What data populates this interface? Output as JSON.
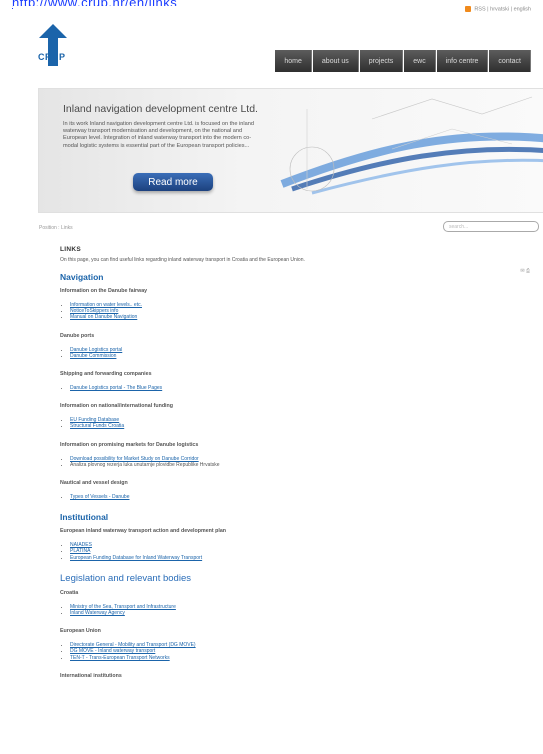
{
  "browser": {
    "url": "http://www.crup.hr/en/links"
  },
  "header": {
    "rss_label": "RSS",
    "languages": "| hrvatski | english",
    "logo_text": "CRUP",
    "nav": [
      "home",
      "about us",
      "projects",
      "ewc",
      "info centre",
      "contact"
    ]
  },
  "hero": {
    "title": "Inland navigation development centre Ltd.",
    "text": "In its work Inland navigation development centre Ltd. is focused on the inland waterway transport modernisation and development, on the national and European level. Integration of inland waterway transport into the modern co-modal logistic systems is essential part of the European transport policies...",
    "button_label": "Read more"
  },
  "breadcrumb": "Position : Links",
  "search": {
    "placeholder": "search..."
  },
  "content": {
    "heading": "LINKS",
    "intro": "On this page, you can find useful links regarding inland waterway transport in Croatia and the European Union.",
    "tools": "✉ ⎙",
    "sections": [
      {
        "title": "Navigation",
        "groups": [
          {
            "title": "Information on the Danube fairway",
            "links": [
              "Information on water levels.. etc.",
              "NoticeToSkippers info",
              "Manual on Danube Navigation"
            ]
          },
          {
            "title": "Danube ports",
            "links": [
              "Danube Logistics portal",
              "Danube Commission"
            ]
          },
          {
            "title": "Shipping and forwarding companies",
            "links": [
              "Danube Logistics portal - The Blue Pages"
            ]
          },
          {
            "title": "Information on national/international funding",
            "links": [
              "EU Funding Database",
              "Structural Funds Croatia"
            ]
          },
          {
            "title": "Information on promising markets for Danube logistics",
            "links": [
              "Download possibility for Market Study on Danube Corridor"
            ],
            "plain": [
              "Analiza plovnog rezerja luka unutarnje plovidbe Republike Hrvatske"
            ]
          },
          {
            "title": "Nautical and vessel design",
            "links": [
              "Types of Vessels - Danube"
            ]
          }
        ]
      },
      {
        "title": "Institutional",
        "groups": [
          {
            "title": "European inland waterway transport action and development plan",
            "links": [
              "NAIADES",
              "PLATINA",
              "European Funding Database for Inland Waterway Transport"
            ]
          }
        ]
      },
      {
        "title": "Legislation and relevant bodies",
        "groups": [
          {
            "title": "Croatia",
            "links": [
              "Ministry of the Sea, Transport and Infrastructure",
              "Inland Waterway Agency"
            ]
          },
          {
            "title": "European Union",
            "links": [
              "Directorate General - Mobility and Transport (DG MOVE)",
              "DG MOVE - Inland waterway transport",
              "TEN-T - Trans-European Transport Networks"
            ]
          },
          {
            "title": "International institutions",
            "links": []
          }
        ]
      }
    ]
  }
}
